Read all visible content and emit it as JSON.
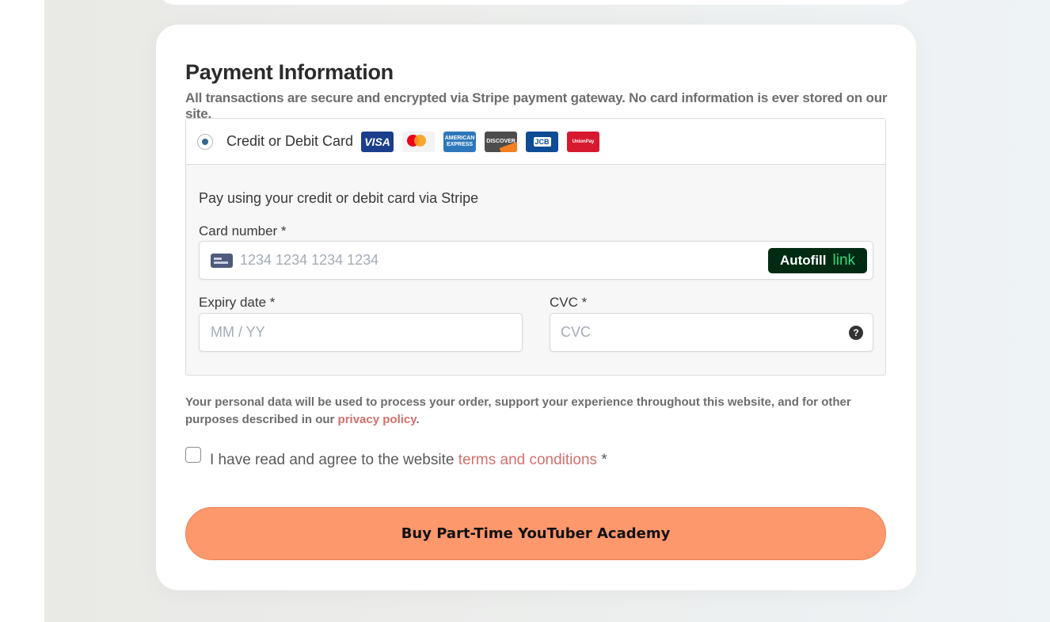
{
  "payment": {
    "title": "Payment Information",
    "subtitle": "All transactions are secure and encrypted via Stripe payment gateway. No card information is ever stored on our site.",
    "method_label": "Credit or Debit Card",
    "brands": [
      "VISA",
      "mastercard",
      "AMERICAN EXPRESS",
      "DISCOVER",
      "JCB",
      "UnionPay"
    ],
    "description": "Pay using your credit or debit card via Stripe",
    "card_number": {
      "label": "Card number *",
      "placeholder": "1234 1234 1234 1234",
      "value": ""
    },
    "autofill": {
      "label": "Autofill",
      "link": "link"
    },
    "expiry": {
      "label": "Expiry date *",
      "placeholder": "MM / YY",
      "value": ""
    },
    "cvc": {
      "label": "CVC *",
      "placeholder": "CVC",
      "value": ""
    },
    "selected_method": "card"
  },
  "privacy": {
    "text": "Your personal data will be used to process your order, support your experience throughout this website, and for other purposes described in our ",
    "link": "privacy policy",
    "suffix": "."
  },
  "terms": {
    "prefix": "I have read and agree to the website ",
    "link": "terms and conditions",
    "suffix": " *",
    "checked": false
  },
  "buy_button": {
    "label": "Buy Part-Time YouTuber Academy",
    "color": "#fd976c"
  },
  "colors": {
    "link": "#d2706b",
    "radio_selected": "#2e6c8e",
    "autofill_bg": "#012a13",
    "autofill_link": "#32d97a"
  }
}
